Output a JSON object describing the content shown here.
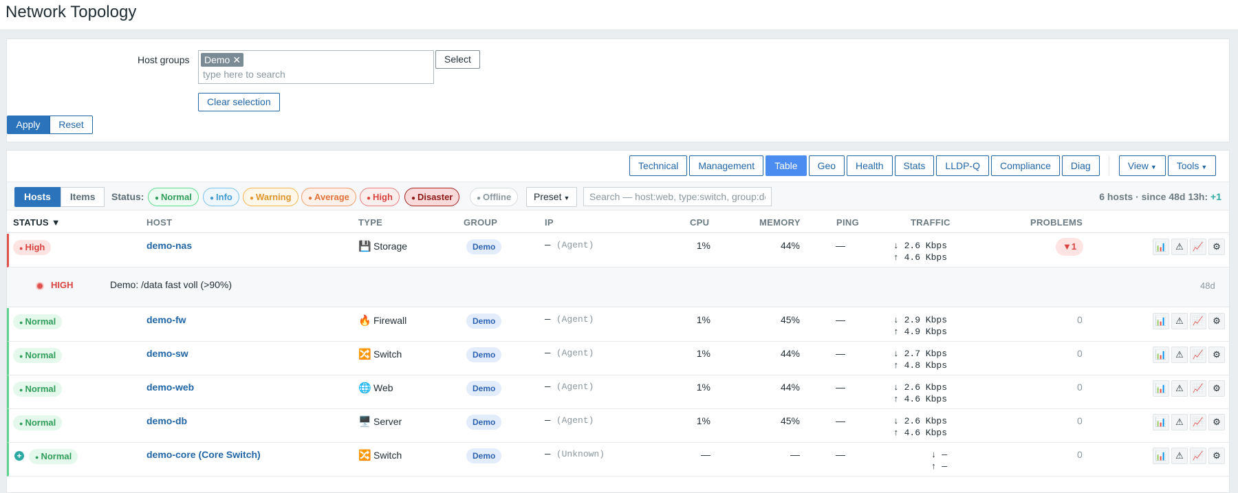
{
  "page": {
    "title": "Network Topology"
  },
  "filter": {
    "host_groups_label": "Host groups",
    "selected_chip": "Demo",
    "chip_remove": "✕",
    "search_placeholder": "type here to search",
    "select_label": "Select",
    "clear_label": "Clear selection",
    "apply_label": "Apply",
    "reset_label": "Reset"
  },
  "views": {
    "tabs": [
      "Technical",
      "Management",
      "Table",
      "Geo",
      "Health",
      "Stats",
      "LLDP-Q",
      "Compliance",
      "Diag"
    ],
    "active": "Table",
    "view_label": "View",
    "tools_label": "Tools"
  },
  "toolbar": {
    "hosts_label": "Hosts",
    "items_label": "Items",
    "status_label": "Status:",
    "pills": {
      "normal": "Normal",
      "info": "Info",
      "warning": "Warning",
      "average": "Average",
      "high": "High",
      "disaster": "Disaster",
      "offline": "Offline"
    },
    "preset_label": "Preset",
    "search_placeholder": "Search — host:web, type:switch, group:dc",
    "summary": "6 hosts · since 48d 13h:",
    "summary_plus": "+1"
  },
  "columns": {
    "status": "STATUS ▼",
    "host": "HOST",
    "type": "TYPE",
    "group": "GROUP",
    "ip": "IP",
    "cpu": "CPU",
    "memory": "MEMORY",
    "ping": "PING",
    "traffic": "TRAFFIC",
    "problems": "PROBLEMS"
  },
  "rows": [
    {
      "status": "High",
      "host": "demo-nas",
      "type_icon": "💾",
      "type": "Storage",
      "group": "Demo",
      "ip_dash": "—",
      "ip_agent": "(Agent)",
      "cpu": "1%",
      "memory": "44%",
      "ping": "—",
      "traffic_down": "↓ 2.6 Kbps",
      "traffic_up": "↑ 4.6 Kbps",
      "problems": "▼1"
    },
    {
      "status": "Normal",
      "host": "demo-fw",
      "type_icon": "🔥",
      "type": "Firewall",
      "group": "Demo",
      "ip_dash": "—",
      "ip_agent": "(Agent)",
      "cpu": "1%",
      "memory": "45%",
      "ping": "—",
      "traffic_down": "↓ 2.9 Kbps",
      "traffic_up": "↑ 4.9 Kbps",
      "problems": "0"
    },
    {
      "status": "Normal",
      "host": "demo-sw",
      "type_icon": "🔀",
      "type": "Switch",
      "group": "Demo",
      "ip_dash": "—",
      "ip_agent": "(Agent)",
      "cpu": "1%",
      "memory": "44%",
      "ping": "—",
      "traffic_down": "↓ 2.7 Kbps",
      "traffic_up": "↑ 4.8 Kbps",
      "problems": "0"
    },
    {
      "status": "Normal",
      "host": "demo-web",
      "type_icon": "🌐",
      "type": "Web",
      "group": "Demo",
      "ip_dash": "—",
      "ip_agent": "(Agent)",
      "cpu": "1%",
      "memory": "44%",
      "ping": "—",
      "traffic_down": "↓ 2.6 Kbps",
      "traffic_up": "↑ 4.6 Kbps",
      "problems": "0"
    },
    {
      "status": "Normal",
      "host": "demo-db",
      "type_icon": "🖥️",
      "type": "Server",
      "group": "Demo",
      "ip_dash": "—",
      "ip_agent": "(Agent)",
      "cpu": "1%",
      "memory": "45%",
      "ping": "—",
      "traffic_down": "↓ 2.6 Kbps",
      "traffic_up": "↑ 4.6 Kbps",
      "problems": "0"
    },
    {
      "status": "Normal",
      "host": "demo-core (Core Switch)",
      "type_icon": "🔀",
      "type": "Switch",
      "group": "Demo",
      "ip_dash": "—",
      "ip_agent": "(Unknown)",
      "cpu": "—",
      "memory": "—",
      "ping": "—",
      "traffic_down": "↓ —",
      "traffic_up": "↑ —",
      "problems": "0"
    }
  ],
  "problem": {
    "severity": "HIGH",
    "description": "Demo: /data fast voll (>90%)",
    "age": "48d"
  },
  "row_actions": [
    "📊",
    "⚠",
    "📈",
    "⚙"
  ],
  "colors": {
    "accent": "#2b73ba",
    "high": "#d9423e",
    "normal": "#2e9e5a"
  }
}
